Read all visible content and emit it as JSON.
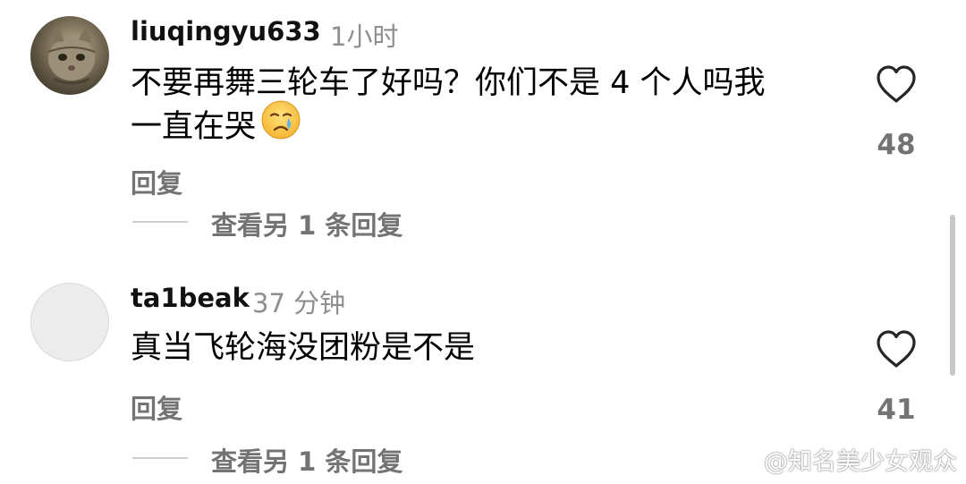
{
  "comments": [
    {
      "username": "liuqingyu633",
      "time": "1小时",
      "text_line1": "不要再舞三轮车了好吗？你们不是 4 个人吗我",
      "text_line2": "一直在哭",
      "emoji_icon": "crying-face-emoji",
      "reply_label": "回复",
      "view_more_label": "查看另 1 条回复",
      "likes": "48"
    },
    {
      "username": "ta1beak",
      "time": "37 分钟",
      "text_line1": "真当飞轮海没团粉是不是",
      "reply_label": "回复",
      "view_more_label": "查看另 1 条回复",
      "likes": "41"
    }
  ],
  "watermark": {
    "text": "@知名美少女观众",
    "icon": "weibo-icon"
  },
  "colors": {
    "username": "#111111",
    "secondary": "#8e8e8e",
    "action": "#737373",
    "heart_stroke": "#262626"
  }
}
